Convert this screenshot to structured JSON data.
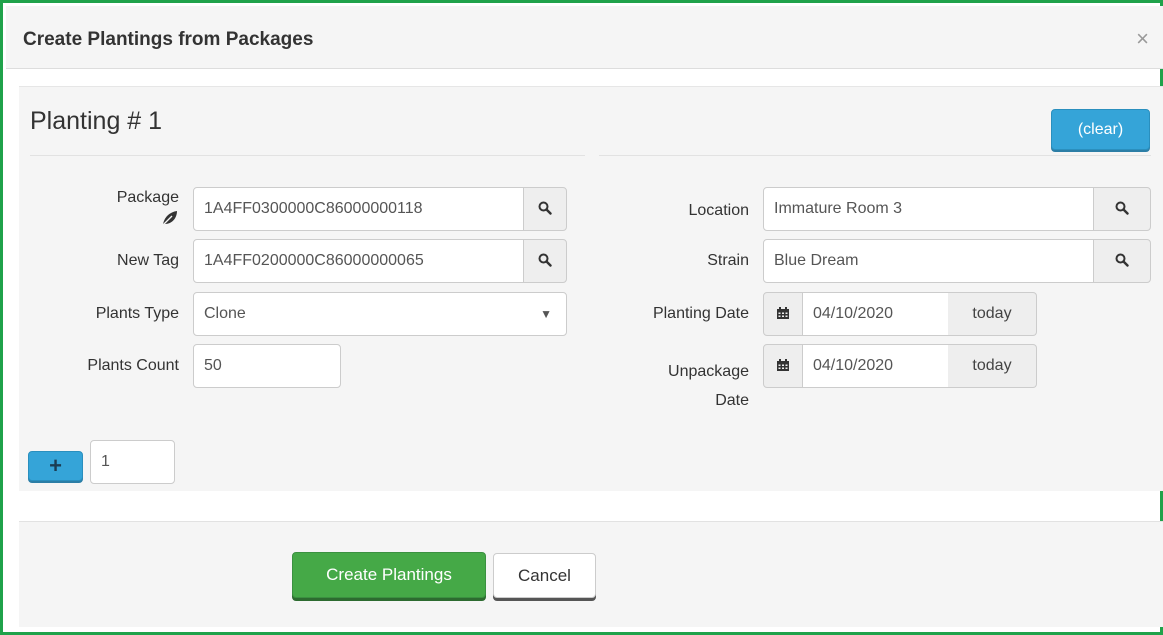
{
  "dialog": {
    "title": "Create Plantings from Packages",
    "close_label": "×"
  },
  "planting": {
    "heading": "Planting # 1",
    "clear_label": "(clear)"
  },
  "form": {
    "package_label": "Package",
    "package_value": "1A4FF0300000C86000000118",
    "new_tag_label": "New Tag",
    "new_tag_value": "1A4FF0200000C86000000065",
    "plants_type_label": "Plants Type",
    "plants_type_value": "Clone",
    "plants_count_label": "Plants Count",
    "plants_count_value": "50",
    "location_label": "Location",
    "location_value": "Immature Room 3",
    "strain_label": "Strain",
    "strain_value": "Blue Dream",
    "planting_date_label": "Planting Date",
    "planting_date_value": "04/10/2020",
    "unpackage_date_label_1": "Unpackage",
    "unpackage_date_label_2": "Date",
    "unpackage_date_value": "04/10/2020",
    "today_label": "today"
  },
  "add_row": {
    "plus_label": "+",
    "count_value": "1"
  },
  "footer": {
    "create_label": "Create Plantings",
    "cancel_label": "Cancel"
  },
  "colors": {
    "frame_border": "#1fa24a",
    "primary_blue": "#35a4d8",
    "success_green": "#45a947"
  },
  "icons": [
    "close-icon",
    "leaf-icon",
    "search-icon",
    "calendar-icon",
    "plus-icon",
    "dropdown-caret-icon"
  ]
}
